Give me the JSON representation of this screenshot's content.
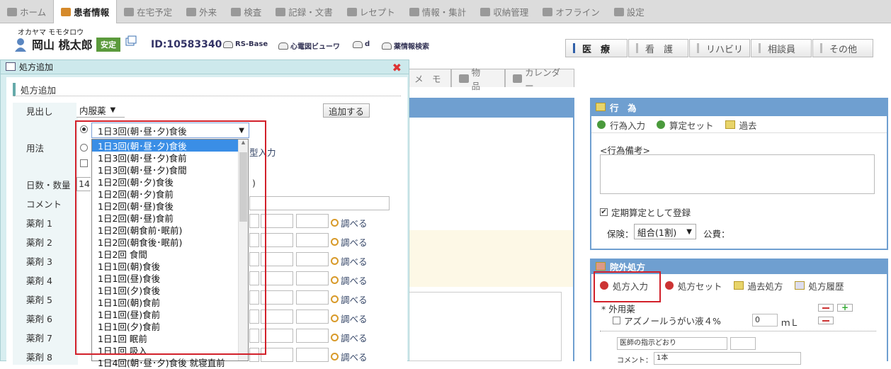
{
  "top_nav": [
    {
      "label": "ホーム",
      "active": false
    },
    {
      "label": "患者情報",
      "active": true
    },
    {
      "label": "在宅予定",
      "active": false
    },
    {
      "label": "外来",
      "active": false
    },
    {
      "label": "検査",
      "active": false
    },
    {
      "label": "記録・文書",
      "active": false
    },
    {
      "label": "レセプト",
      "active": false
    },
    {
      "label": "情報・集計",
      "active": false
    },
    {
      "label": "収納管理",
      "active": false
    },
    {
      "label": "オフライン",
      "active": false
    },
    {
      "label": "設定",
      "active": false
    }
  ],
  "patient": {
    "kana": "オカヤマ モモタロウ",
    "name": "岡山 桃太郎",
    "status_badge": "安定",
    "id": "ID:10583340"
  },
  "tools": [
    "RS-Base",
    "心電図ビューワ",
    "d",
    "薬情報検索"
  ],
  "departments": [
    "医　療",
    "看　護",
    "リハビリ",
    "相談員",
    "その他"
  ],
  "subtabs": [
    "メ　モ",
    "物　品",
    "カレンダー"
  ],
  "dialog": {
    "title": "処方追加",
    "section": "処方追加",
    "labels": {
      "heading": "見出し",
      "usage": "用法",
      "days_qty": "日数・数量",
      "comment": "コメント",
      "drug1": "薬剤 1",
      "drug2": "薬剤 2",
      "drug3": "薬剤 3",
      "drug4": "薬剤 4",
      "drug5": "薬剤 5",
      "drug6": "薬剤 6",
      "drug7": "薬剤 7",
      "drug8": "薬剤 8"
    },
    "heading_select": "内服薬",
    "add_button": "追加する",
    "usage_select": "1日3回(朝･昼･夕)食後",
    "free_input_suffix": "型入力",
    "days_value": "14",
    "paren_close": ")",
    "lookup_label": "調べる",
    "usage_options": [
      "1日3回(朝･昼･夕)食後",
      "1日3回(朝･昼･夕)食前",
      "1日3回(朝･昼･夕)食間",
      "1日2回(朝･夕)食後",
      "1日2回(朝･夕)食前",
      "1日2回(朝･昼)食後",
      "1日2回(朝･昼)食前",
      "1日2回(朝食前･眠前)",
      "1日2回(朝食後･眠前)",
      "1日2回 食間",
      "1日1回(朝)食後",
      "1日1回(昼)食後",
      "1日1回(夕)食後",
      "1日1回(朝)食前",
      "1日1回(昼)食前",
      "1日1回(夕)食前",
      "1日1回 眠前",
      "1日1回 吸入",
      "1日4回(朝･昼･夕)食後 就寝直前"
    ]
  },
  "acts_panel": {
    "title": "行　為",
    "buttons": [
      "行為入力",
      "算定セット",
      "過去"
    ],
    "note_placeholder": "<行為備考>",
    "regular_checkbox": "定期算定として登録",
    "insurance_label": "保険：",
    "insurance_value": "組合(1割)",
    "public_label": "公費："
  },
  "outside_panel": {
    "title": "院外処方",
    "buttons": [
      "処方入力",
      "処方セット",
      "過去処方",
      "処方履歴"
    ],
    "category": "* 外用薬",
    "drug_name": "アズノールうがい液４%",
    "qty": "0",
    "unit": "ｍＬ",
    "instruction": "医師の指示どおり",
    "comment_label": "コメント：",
    "comment_value": "1本"
  }
}
